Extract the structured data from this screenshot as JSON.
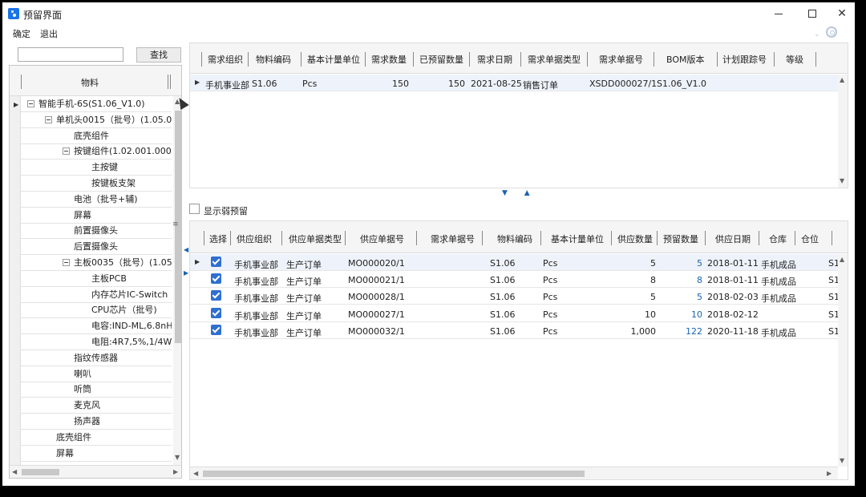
{
  "window": {
    "title": "预留界面"
  },
  "menu": {
    "confirm": "确定",
    "exit": "退出"
  },
  "search": {
    "value": "",
    "button": "查找"
  },
  "tree": {
    "header": "物料",
    "items": [
      {
        "label": "智能手机-6S(S1.06_V1.0)",
        "level": 0,
        "expanded": true
      },
      {
        "label": "单机头0015（批号）(1.05.0(",
        "level": 1,
        "expanded": true
      },
      {
        "label": "底壳组件",
        "level": 2
      },
      {
        "label": "按键组件(1.02.001.0002",
        "level": 2,
        "expanded": true
      },
      {
        "label": "主按键",
        "level": 3
      },
      {
        "label": "按键板支架",
        "level": 3
      },
      {
        "label": "电池（批号+辅)",
        "level": 2
      },
      {
        "label": "屏幕",
        "level": 2
      },
      {
        "label": "前置摄像头",
        "level": 2
      },
      {
        "label": "后置摄像头",
        "level": 2
      },
      {
        "label": "主板0035（批号）(1.05",
        "level": 2,
        "expanded": true
      },
      {
        "label": "主板PCB",
        "level": 3
      },
      {
        "label": "内存芯片IC-Switch",
        "level": 3
      },
      {
        "label": "CPU芯片（批号)",
        "level": 3
      },
      {
        "label": "电容:IND-ML,6.8nH",
        "level": 3
      },
      {
        "label": "电阻:4R7,5%,1/4W,",
        "level": 3
      },
      {
        "label": "指纹传感器",
        "level": 2
      },
      {
        "label": "喇叭",
        "level": 2
      },
      {
        "label": "听筒",
        "level": 2
      },
      {
        "label": "麦克风",
        "level": 2
      },
      {
        "label": "扬声器",
        "level": 2
      },
      {
        "label": "底壳组件",
        "level": 1
      },
      {
        "label": "屏幕",
        "level": 1
      }
    ]
  },
  "demand": {
    "columns": [
      "需求组织",
      "物料编码",
      "基本计量单位",
      "需求数量",
      "已预留数量",
      "需求日期",
      "需求单据类型",
      "需求单据号",
      "BOM版本",
      "计划跟踪号",
      "等级"
    ],
    "rows": [
      {
        "org": "手机事业部",
        "material": "S1.06",
        "unit": "Pcs",
        "qty": "150",
        "reserved": "150",
        "date": "2021-08-25",
        "type": "销售订单",
        "bill": "XSDD000027/1",
        "bom": "S1.06_V1.0"
      }
    ]
  },
  "weak": {
    "label": "显示弱预留"
  },
  "supply": {
    "columns": [
      "选择",
      "供应组织",
      "供应单据类型",
      "供应单据号",
      "需求单据号",
      "物料编码",
      "基本计量单位",
      "供应数量",
      "预留数量",
      "供应日期",
      "仓库",
      "仓位"
    ],
    "rows": [
      {
        "org": "手机事业部",
        "type": "生产订单",
        "bill": "MO000020/1",
        "material": "S1.06",
        "unit": "Pcs",
        "qty": "5",
        "reserved": "5",
        "date": "2018-01-11",
        "warehouse": "手机成品",
        "loc": "S1"
      },
      {
        "org": "手机事业部",
        "type": "生产订单",
        "bill": "MO000021/1",
        "material": "S1.06",
        "unit": "Pcs",
        "qty": "8",
        "reserved": "8",
        "date": "2018-01-11",
        "warehouse": "手机成品",
        "loc": "S1"
      },
      {
        "org": "手机事业部",
        "type": "生产订单",
        "bill": "MO000028/1",
        "material": "S1.06",
        "unit": "Pcs",
        "qty": "5",
        "reserved": "5",
        "date": "2018-02-03",
        "warehouse": "手机成品",
        "loc": "S1"
      },
      {
        "org": "手机事业部",
        "type": "生产订单",
        "bill": "MO000027/1",
        "material": "S1.06",
        "unit": "Pcs",
        "qty": "10",
        "reserved": "10",
        "date": "2018-02-12",
        "warehouse": "",
        "loc": "S1"
      },
      {
        "org": "手机事业部",
        "type": "生产订单",
        "bill": "MO000032/1",
        "material": "S1.06",
        "unit": "Pcs",
        "qty": "1,000",
        "reserved": "122",
        "date": "2020-11-18",
        "warehouse": "手机成品",
        "loc": "S1"
      }
    ]
  }
}
